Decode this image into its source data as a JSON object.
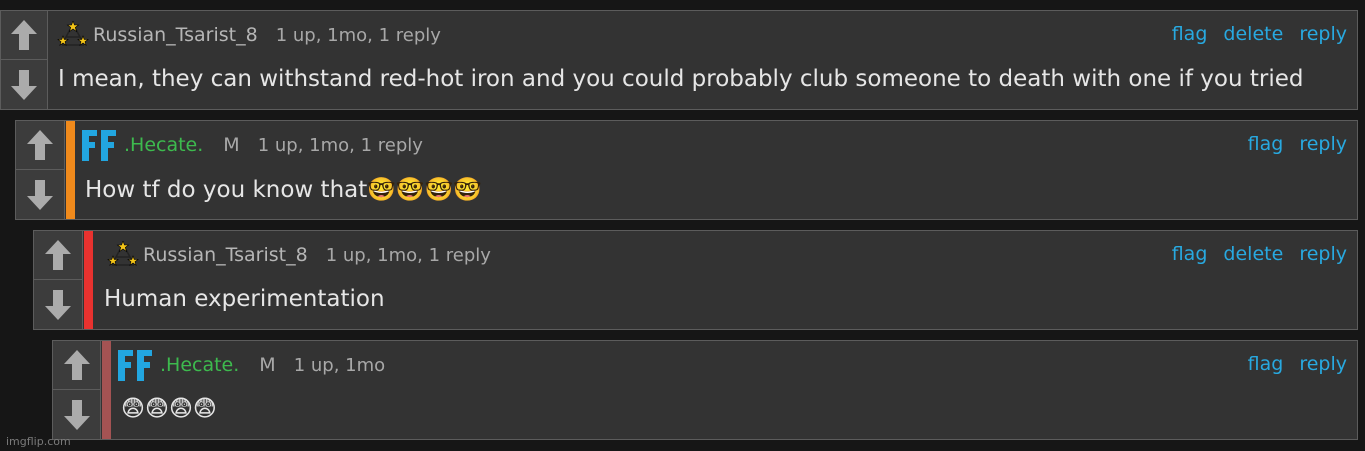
{
  "comments": [
    {
      "username": "Russian_Tsarist_8",
      "badge": "",
      "meta": "1 up, 1mo, 1 reply",
      "actions": [
        "flag",
        "delete",
        "reply"
      ],
      "text": "I mean, they can withstand red-hot iron and you could probably club someone to death with one if you tried",
      "avatar": "tsar-stars-icon"
    },
    {
      "username": ".Hecate.",
      "badge": "M",
      "meta": "1 up, 1mo, 1 reply",
      "actions": [
        "flag",
        "reply"
      ],
      "text": "How tf do you know that🤓🤓🤓🤓",
      "avatar": "ff-logo-icon",
      "accent_color": "#f08a1c"
    },
    {
      "username": "Russian_Tsarist_8",
      "badge": "",
      "meta": "1 up, 1mo, 1 reply",
      "actions": [
        "flag",
        "delete",
        "reply"
      ],
      "text": "Human experimentation",
      "avatar": "tsar-stars-icon",
      "accent_color": "#e8322f"
    },
    {
      "username": ".Hecate.",
      "badge": "M",
      "meta": "1 up, 1mo",
      "actions": [
        "flag",
        "reply"
      ],
      "text": "😨😨😨😨",
      "avatar": "ff-logo-icon",
      "accent_color": "#a45353"
    }
  ],
  "watermark": "imgflip.com",
  "colors": {
    "link": "#28a9e0",
    "username_green": "#3dba4e",
    "panel": "#333333",
    "border": "#5c5c5c"
  }
}
